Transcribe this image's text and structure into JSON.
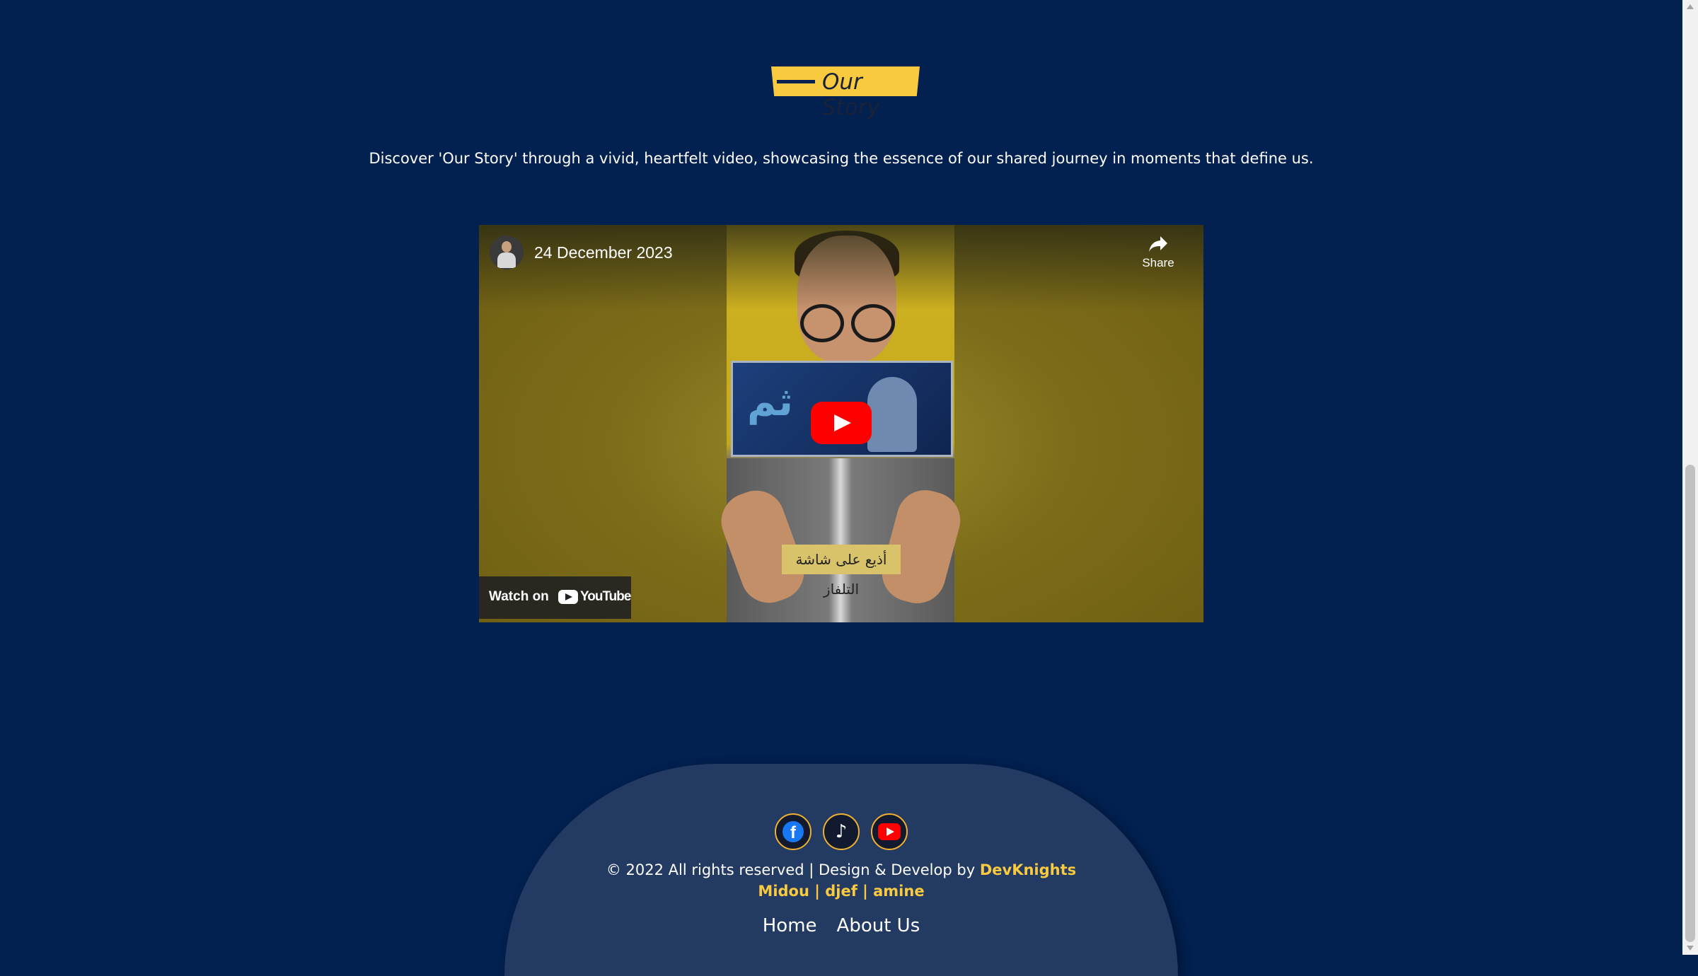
{
  "section": {
    "title": "Our Story",
    "intro": "Discover 'Our Story' through a vivid, heartfelt video, showcasing the essence of our shared journey in moments that define us."
  },
  "video": {
    "title": "24 December 2023",
    "share_label": "Share",
    "watch_on_label": "Watch on",
    "youtube_wordmark": "YouTube",
    "caption": "أذيع على شاشة التلفاز",
    "play_icon": "play-icon",
    "colors": {
      "play_button": "#ff0000",
      "background": "#726416"
    }
  },
  "footer": {
    "socials": [
      {
        "name": "facebook",
        "icon": "facebook-icon"
      },
      {
        "name": "tiktok",
        "icon": "tiktok-icon"
      },
      {
        "name": "youtube",
        "icon": "youtube-icon"
      }
    ],
    "copyright_text": "© 2022 All rights reserved | Design & Develop by",
    "brand": "DevKnights",
    "team": "Midou | djef | amine",
    "nav": [
      "Home",
      "About Us"
    ]
  },
  "theme": {
    "background": "#022050",
    "accent": "#f9c940",
    "footer_bg": "#233a62"
  }
}
